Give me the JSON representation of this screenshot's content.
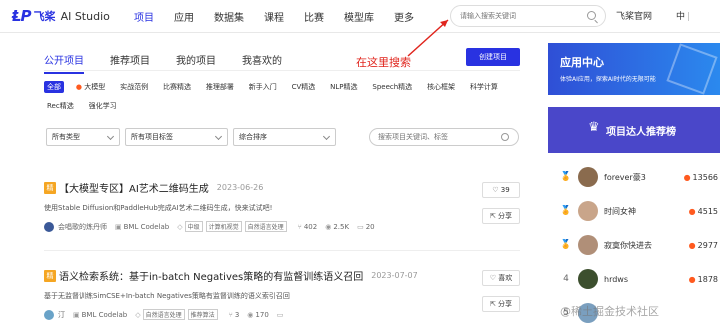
{
  "header": {
    "logo_mark": "ⱠP",
    "brand": "飞桨",
    "product": "AI Studio",
    "nav": [
      "项目",
      "应用",
      "数据集",
      "课程",
      "比赛",
      "模型库",
      "更多"
    ],
    "search_placeholder": "请输入搜索关键词",
    "official_link": "飞桨官网",
    "lang_label": "中"
  },
  "annotation": {
    "text": "在这里搜索",
    "color": "#e0251d"
  },
  "tabs": [
    "公开项目",
    "推荐项目",
    "我的项目",
    "我喜欢的"
  ],
  "create_button": "创建项目",
  "categories": [
    "全部",
    "大模型",
    "实战范例",
    "比赛精选",
    "推理部署",
    "新手入门",
    "CV精选",
    "NLP精选",
    "Speech精选",
    "核心框架",
    "科学计算",
    "Rec精选",
    "强化学习"
  ],
  "filters": {
    "type": "所有类型",
    "tags": "所有项目标签",
    "sort": "综合排序",
    "search_placeholder": "搜索项目关键词、标签"
  },
  "projects": [
    {
      "badge": "精",
      "title": "【大模型专区】AI艺术二维码生成",
      "date": "2023-06-26",
      "desc": "使用Stable Diffusion和PaddleHub完成AI艺术二维码生成，快来试试吧!",
      "author": "会唱歌的炼丹师",
      "env": "BML Codelab",
      "tags": [
        "中级",
        "计算机视觉",
        "自然语言处理"
      ],
      "forks": "402",
      "views": "2.5K",
      "comments": "20",
      "likes": "39",
      "share": "分享"
    },
    {
      "badge": "精",
      "title": "语义检索系统：基于in-batch Negatives策略的有监督训练语义召回",
      "date": "2023-07-07",
      "desc": "基于无监督训练SimCSE+In-batch Negatives策略有监督训练的语义索引召回",
      "author": "汀",
      "env": "BML Codelab",
      "tags": [
        "自然语言处理",
        "推荐算法"
      ],
      "forks": "3",
      "views": "170",
      "comments": "",
      "likes": "喜欢",
      "share": "分享"
    }
  ],
  "sidebar": {
    "app_center_title": "应用中心",
    "app_center_sub": "体验AI应用，探索AI时代的无限可能",
    "leaderboard_title": "项目达人推荐榜",
    "leaders": [
      {
        "rank": "1",
        "name": "forever豪3",
        "score": "13566",
        "color": "#8a6b4e"
      },
      {
        "rank": "2",
        "name": "时间女神",
        "score": "4515",
        "color": "#c9a58a"
      },
      {
        "rank": "3",
        "name": "寂寞你快进去",
        "score": "2977",
        "color": "#b08f78"
      },
      {
        "rank": "4",
        "name": "hrdws",
        "score": "1878",
        "color": "#3c4f2e"
      },
      {
        "rank": "5",
        "name": "",
        "score": "",
        "color": "#7a9fbf"
      }
    ]
  },
  "watermark": "@稀土掘金技术社区",
  "colors": {
    "accent": "#2932e1",
    "fire": "#ff5a1f",
    "featured": "#f5a623"
  }
}
